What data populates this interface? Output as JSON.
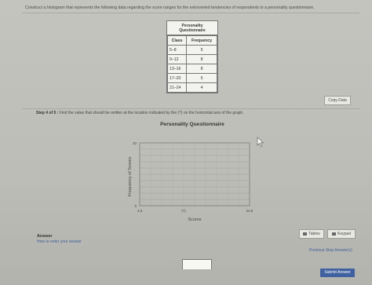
{
  "prompt": "Construct a histogram that represents the following data regarding the score ranges for the extroverted tendencies of respondents to a personality questionnaire.",
  "table": {
    "title_line1": "Personality",
    "title_line2": "Questionnaire",
    "headers": [
      "Class",
      "Frequency"
    ],
    "rows": [
      [
        "5–8",
        "5"
      ],
      [
        "9–12",
        "8"
      ],
      [
        "13–16",
        "8"
      ],
      [
        "17–20",
        "5"
      ],
      [
        "21–24",
        "4"
      ]
    ]
  },
  "copy_data": "Copy Data",
  "step": {
    "label": "Step 4 of 5 :",
    "text": "Find the value that should be written at the location indicated by the (?) on the horizontal axis of the graph."
  },
  "chart_data": {
    "type": "bar",
    "title": "Personality Questionnaire",
    "xlabel": "Scores",
    "ylabel": "Frequency of Scores",
    "ylim": [
      0,
      10
    ],
    "y_ticks": [
      "0",
      "10"
    ],
    "x_ticks": [
      "4.5",
      "(?)",
      "24.5"
    ],
    "grid": true,
    "values": []
  },
  "answer": {
    "label": "Answer",
    "how_to": "How to enter your answer"
  },
  "buttons": {
    "tables": "Tables",
    "keypad": "Keypad",
    "previous": "Previous Step Answer(s)",
    "submit": "Submit Answer"
  }
}
